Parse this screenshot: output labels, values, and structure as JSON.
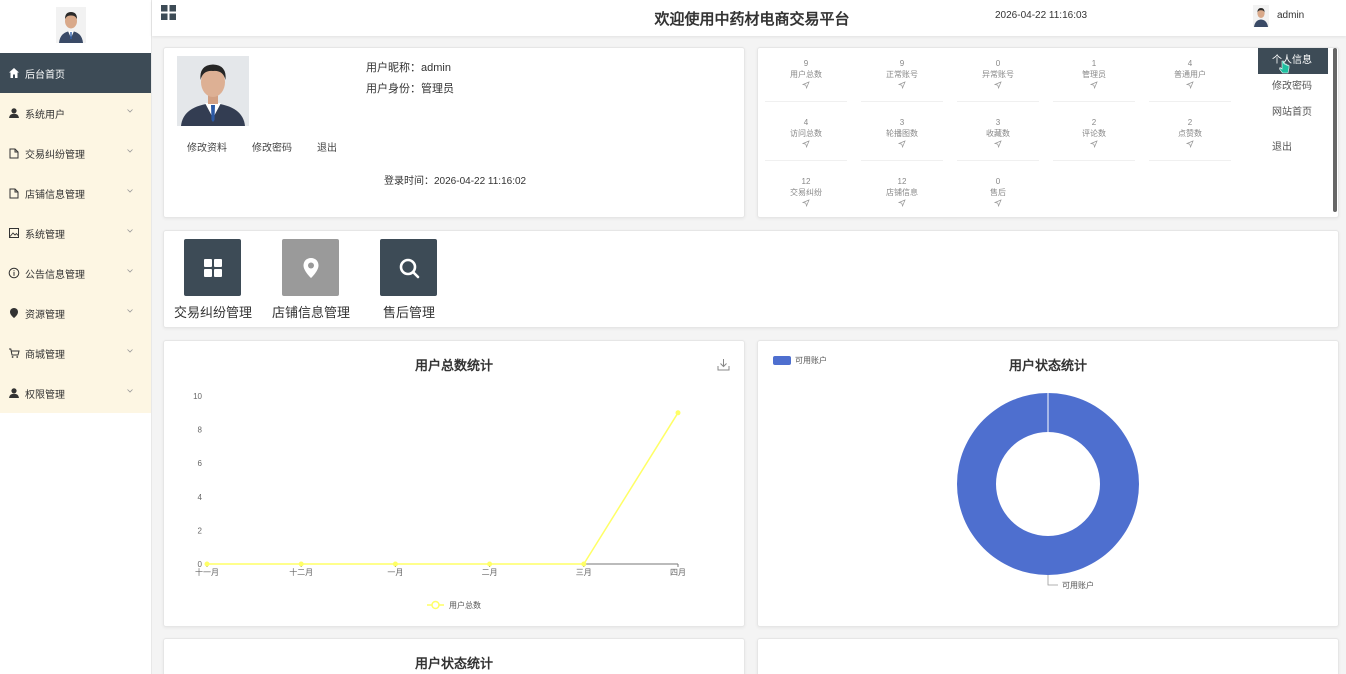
{
  "header": {
    "title": "欢迎使用中药材电商交易平台",
    "datetime": "2026-04-22 11:16:03",
    "username": "admin"
  },
  "sidebar": {
    "items": [
      {
        "label": "后台首页",
        "icon": "home-icon"
      },
      {
        "label": "系统用户",
        "icon": "user-icon"
      },
      {
        "label": "交易纠纷管理",
        "icon": "file-icon"
      },
      {
        "label": "店铺信息管理",
        "icon": "file-icon"
      },
      {
        "label": "系统管理",
        "icon": "image-icon"
      },
      {
        "label": "公告信息管理",
        "icon": "info-icon"
      },
      {
        "label": "资源管理",
        "icon": "location-icon"
      },
      {
        "label": "商城管理",
        "icon": "cart-icon"
      },
      {
        "label": "权限管理",
        "icon": "user-icon"
      }
    ]
  },
  "profile": {
    "nickname_label": "用户昵称：",
    "nickname": "admin",
    "role_label": "用户身份：",
    "role": "管理员",
    "links": [
      "修改资料",
      "修改密码",
      "退出"
    ],
    "login_time_label": "登录时间：",
    "login_time": "2026-04-22 11:16:02"
  },
  "stats": [
    {
      "value": "9",
      "label": "用户总数"
    },
    {
      "value": "9",
      "label": "正常账号"
    },
    {
      "value": "0",
      "label": "异常账号"
    },
    {
      "value": "1",
      "label": "管理员"
    },
    {
      "value": "4",
      "label": "普通用户"
    },
    {
      "value": "4",
      "label": "访问总数"
    },
    {
      "value": "3",
      "label": "轮播图数"
    },
    {
      "value": "3",
      "label": "收藏数"
    },
    {
      "value": "2",
      "label": "评论数"
    },
    {
      "value": "2",
      "label": "点赞数"
    },
    {
      "value": "12",
      "label": "交易纠纷"
    },
    {
      "value": "12",
      "label": "店铺信息"
    },
    {
      "value": "0",
      "label": "售后"
    }
  ],
  "user_menu": {
    "items": [
      "个人信息",
      "修改密码",
      "网站首页",
      "退出"
    ]
  },
  "quick_access": [
    {
      "label": "交易纠纷管理",
      "icon": "grid-icon",
      "color": "#3d4b56"
    },
    {
      "label": "店铺信息管理",
      "icon": "location-icon",
      "color": "#9a9a9a"
    },
    {
      "label": "售后管理",
      "icon": "search-icon",
      "color": "#3d4b56"
    }
  ],
  "charts": {
    "line_title": "用户总数统计",
    "donut_title": "用户状态统计",
    "bottom_left_title": "用户状态统计"
  },
  "chart_data": [
    {
      "type": "line",
      "title": "用户总数统计",
      "categories": [
        "十一月",
        "十二月",
        "一月",
        "二月",
        "三月",
        "四月"
      ],
      "series": [
        {
          "name": "用户总数",
          "values": [
            0,
            0,
            0,
            0,
            0,
            9
          ],
          "color": "#ffff66"
        }
      ],
      "yticks": [
        0,
        2,
        4,
        6,
        8,
        10
      ],
      "ylim": [
        0,
        10
      ],
      "legend": "bottom-center"
    },
    {
      "type": "pie",
      "title": "用户状态统计",
      "labels": [
        "可用账户"
      ],
      "values": [
        9
      ],
      "colors": [
        "#4e6fcf"
      ],
      "legend": "top-left"
    }
  ]
}
